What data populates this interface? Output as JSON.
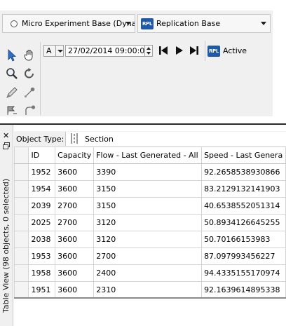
{
  "toolbar": {
    "base_selector": {
      "label": "Micro Experiment Base (Dynam",
      "icon": "radio-icon"
    },
    "replication_selector": {
      "label": "Replication Base",
      "badge": "RPL",
      "icon": "replication-icon"
    }
  },
  "tools": [
    {
      "name": "select-arrow-icon"
    },
    {
      "name": "pan-hand-icon"
    },
    {
      "name": "zoom-icon"
    },
    {
      "name": "rotate-icon"
    },
    {
      "name": "draw-pen-icon"
    },
    {
      "name": "node-tool-icon"
    },
    {
      "name": "flag-tool-icon"
    },
    {
      "name": "connector-tool-icon"
    }
  ],
  "simulation": {
    "mode_value": "A",
    "datetime_value": "27/02/2014 09:00:00",
    "status_badge": "RPL",
    "status_text": "Active"
  },
  "table_view": {
    "side_label": "Table View (98 objects, 0 selected)",
    "object_type_label": "Object Type:",
    "object_type_value": "Section",
    "columns": [
      "ID",
      "Capacity",
      "Flow - Last Generated - All",
      "Speed - Last Genera"
    ],
    "rows": [
      [
        "1952",
        "3600",
        "3390",
        "92.2658538930866"
      ],
      [
        "1954",
        "3600",
        "3150",
        "83.2129132141903"
      ],
      [
        "2039",
        "2700",
        "3150",
        "40.6538552051314"
      ],
      [
        "2025",
        "2700",
        "3120",
        "50.8934126645255"
      ],
      [
        "2038",
        "3600",
        "3120",
        "50.70166153983"
      ],
      [
        "1953",
        "3600",
        "2700",
        "87.097993456227"
      ],
      [
        "1958",
        "3600",
        "2400",
        "94.4335155170974"
      ],
      [
        "1951",
        "3600",
        "2310",
        "92.1639614895338"
      ]
    ]
  },
  "colors": {
    "accent": "#1e5aa8",
    "panel_bg": "#f0f0f0",
    "grid_line": "#d4d4d4"
  }
}
